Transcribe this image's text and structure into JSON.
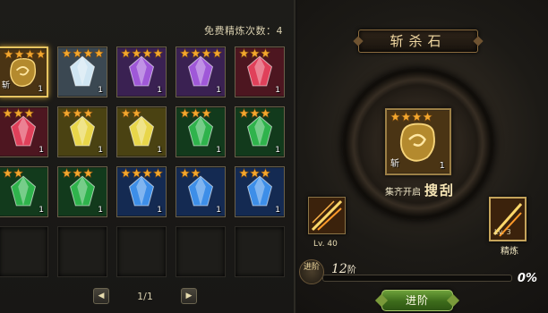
{
  "inventory": {
    "free_refine_label": "免费精炼次数：4",
    "pager": {
      "page": "1/1",
      "prev_icon": "triangle-left-icon",
      "next_icon": "triangle-right-icon"
    },
    "slots": [
      {
        "kind": "gold-ore",
        "stars": 4,
        "count": "1",
        "tag": "斩",
        "selected": true
      },
      {
        "kind": "diamond",
        "stars": 4,
        "count": "1",
        "tag": "",
        "selected": false
      },
      {
        "kind": "amethyst",
        "stars": 4,
        "count": "1",
        "tag": "",
        "selected": false
      },
      {
        "kind": "amethyst",
        "stars": 4,
        "count": "1",
        "tag": "",
        "selected": false
      },
      {
        "kind": "ruby",
        "stars": 3,
        "count": "1",
        "tag": "",
        "selected": false
      },
      {
        "kind": "ruby",
        "stars": 3,
        "count": "1",
        "tag": "",
        "selected": false
      },
      {
        "kind": "topaz",
        "stars": 3,
        "count": "1",
        "tag": "",
        "selected": false
      },
      {
        "kind": "topaz",
        "stars": 2,
        "count": "1",
        "tag": "",
        "selected": false
      },
      {
        "kind": "emerald",
        "stars": 3,
        "count": "1",
        "tag": "",
        "selected": false
      },
      {
        "kind": "emerald",
        "stars": 3,
        "count": "1",
        "tag": "",
        "selected": false
      },
      {
        "kind": "emerald",
        "stars": 2,
        "count": "1",
        "tag": "",
        "selected": false
      },
      {
        "kind": "emerald",
        "stars": 3,
        "count": "1",
        "tag": "",
        "selected": false
      },
      {
        "kind": "sapphire",
        "stars": 4,
        "count": "1",
        "tag": "",
        "selected": false
      },
      {
        "kind": "sapphire",
        "stars": 2,
        "count": "1",
        "tag": "",
        "selected": false
      },
      {
        "kind": "sapphire",
        "stars": 3,
        "count": "1",
        "tag": "",
        "selected": false
      },
      {
        "kind": "empty"
      },
      {
        "kind": "empty"
      },
      {
        "kind": "empty"
      },
      {
        "kind": "empty"
      },
      {
        "kind": "empty"
      }
    ]
  },
  "forge": {
    "title": "斩杀石",
    "main_item": {
      "kind": "gold-ore",
      "stars": 4,
      "count": "1",
      "tag": "斩"
    },
    "gather_label": "集齐开启",
    "skill_name": "搜刮",
    "left_skill_level": "Lv. 40",
    "right_skill_level": "Lv. 3",
    "refine_label": "精炼",
    "advance_emblem_label": "进阶",
    "stage_value": "12",
    "stage_suffix": "阶",
    "progress_percent": "0%",
    "progress_fraction": 0,
    "advance_button": "进阶"
  },
  "colors": {
    "gold-ore": "#b48a2e",
    "diamond": "#cfe5f2",
    "amethyst": "#9f58d8",
    "ruby": "#e0405a",
    "topaz": "#e8d64a",
    "emerald": "#2fb34c",
    "sapphire": "#3d8ee8",
    "star": "#f3a72e"
  }
}
